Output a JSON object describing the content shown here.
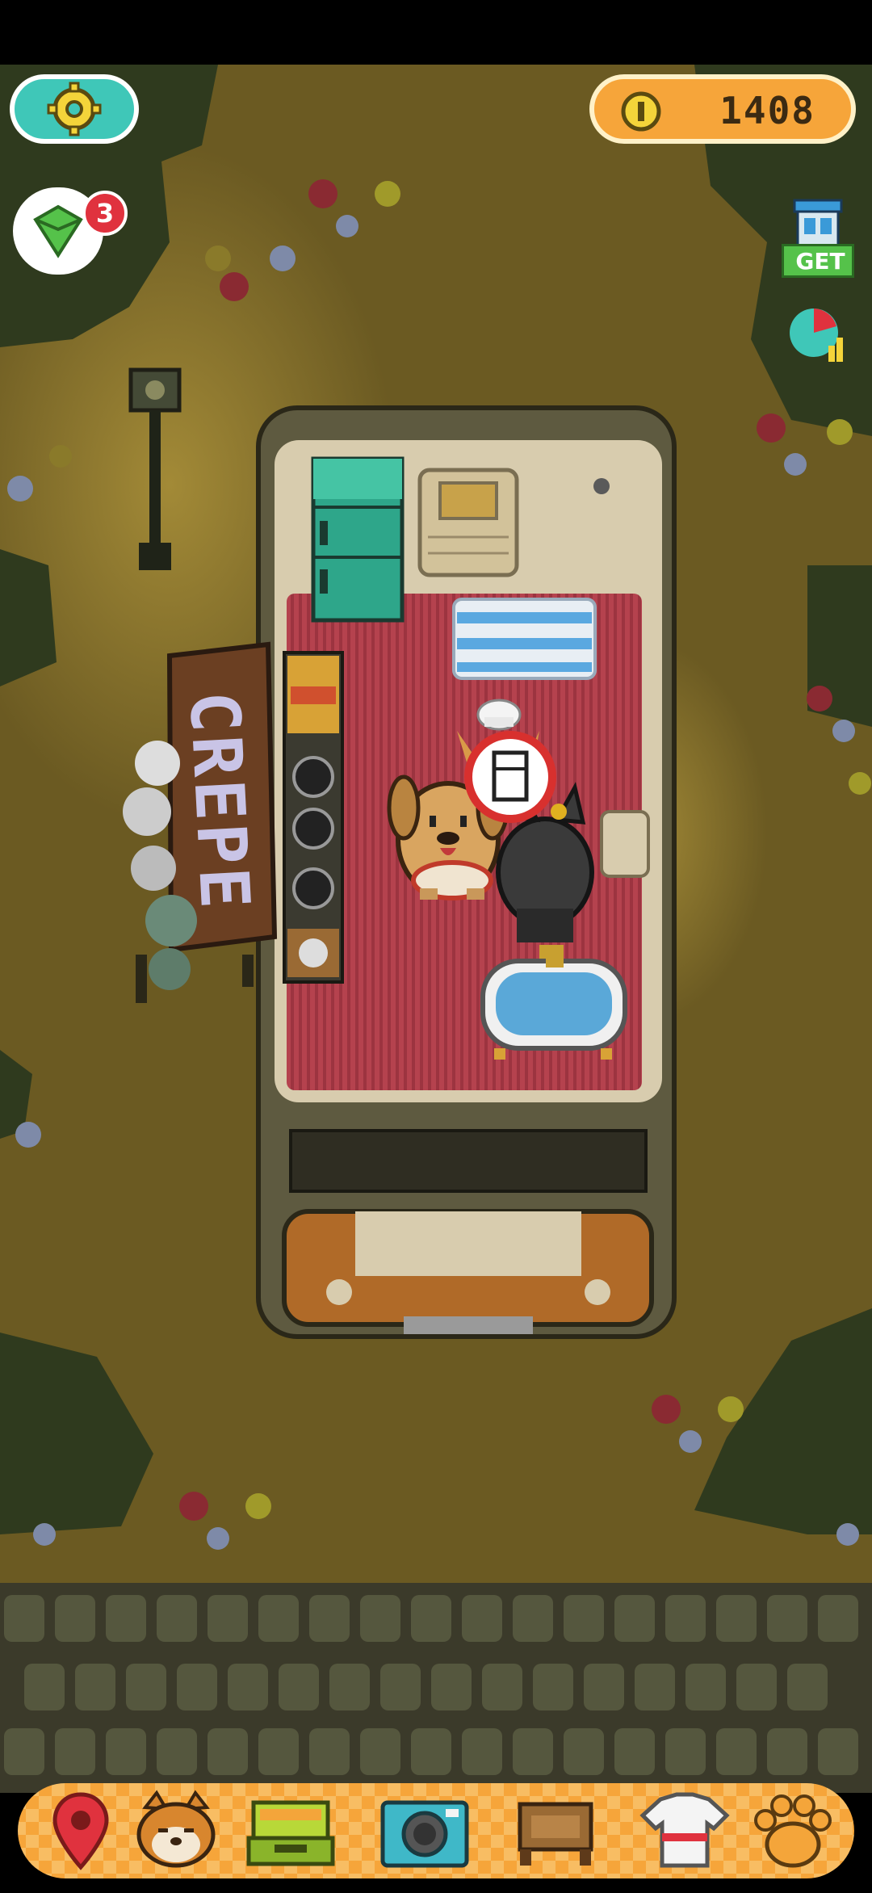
{
  "hud": {
    "coin_count": "1408",
    "notification_count": "3",
    "get_label": "GET"
  },
  "food_truck": {
    "sign_text": "CREPE"
  },
  "bottom_nav": {
    "items": [
      {
        "icon": "map-pin-icon"
      },
      {
        "icon": "shiba-face-icon"
      },
      {
        "icon": "cash-register-icon"
      },
      {
        "icon": "camera-icon"
      },
      {
        "icon": "furniture-chair-icon"
      },
      {
        "icon": "shirt-icon"
      },
      {
        "icon": "paw-icon"
      }
    ]
  },
  "colors": {
    "ground": "#6b5a22",
    "bush": "#2f3a1e",
    "hud_orange": "#f6a53a",
    "hud_teal": "#3fc7b8",
    "badge_red": "#e0323e",
    "rug_red": "#b3414c",
    "fridge_green": "#2ea68a"
  }
}
